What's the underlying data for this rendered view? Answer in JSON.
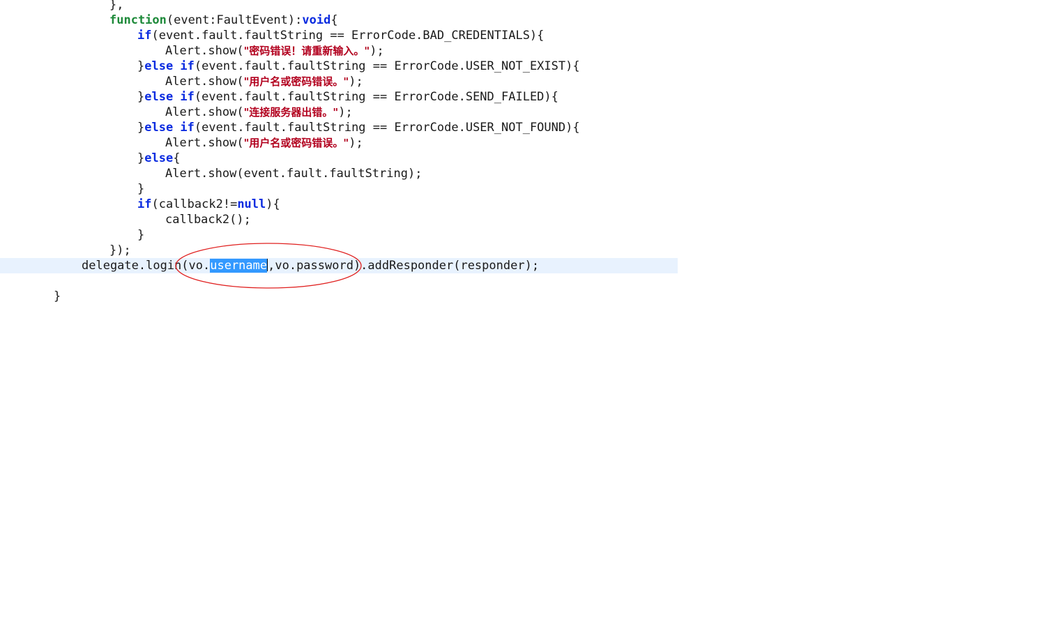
{
  "code": {
    "l1": "},",
    "l2_kw1": "function",
    "l2_mid": "(event:FaultEvent):",
    "l2_kw2": "void",
    "l2_end": "{",
    "if_kw": "if",
    "else_kw": "else",
    "else_if_kw": "else if",
    "cond1": "(event.fault.faultString == ErrorCode.BAD_CREDENTIALS){",
    "alert_pre": "Alert.show(",
    "str1": "\"密码错误！请重新输入。\"",
    "alert_post": ");",
    "brace_close": "}",
    "cond2": "(event.fault.faultString == ErrorCode.USER_NOT_EXIST){",
    "str2": "\"用户名或密码错误。\"",
    "cond3": "(event.fault.faultString == ErrorCode.SEND_FAILED){",
    "str3": "\"连接服务器出错。\"",
    "cond4": "(event.fault.faultString == ErrorCode.USER_NOT_FOUND){",
    "str4": "\"用户名或密码错误。\"",
    "else_open": "{",
    "alert_default": "Alert.show(event.fault.faultString);",
    "cond5_pre": "(callback2!=",
    "null_kw": "null",
    "cond5_post": "){",
    "callback_call": "callback2();",
    "close_paren": "});",
    "login_pre": "delegate.login(vo.",
    "login_sel": "username",
    "login_post": ",vo.password).addResponder(responder);",
    "final_brace": "}"
  },
  "annotation": {
    "ellipse_color": "#e0201f"
  }
}
